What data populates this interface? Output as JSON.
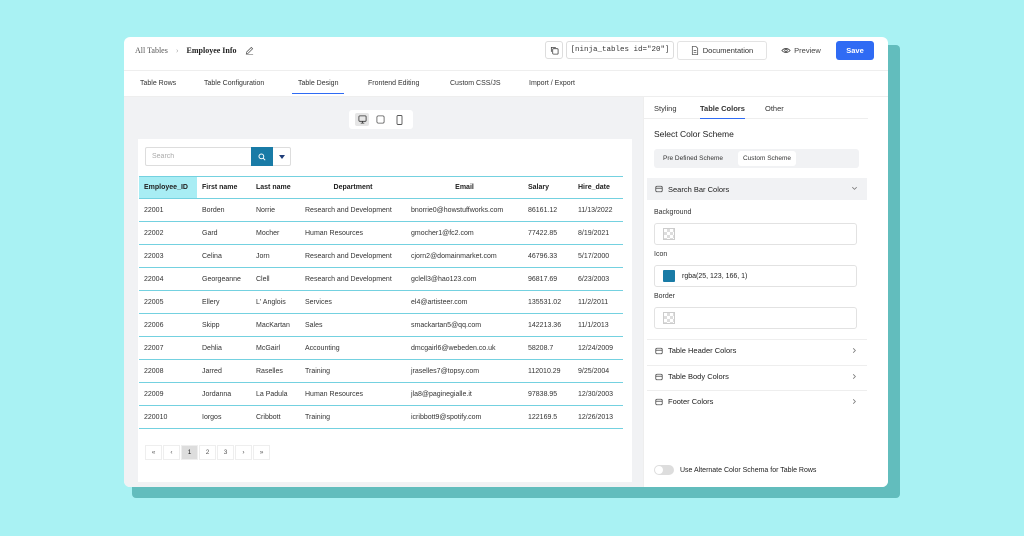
{
  "breadcrumb": {
    "root": "All Tables",
    "current": "Employee Info"
  },
  "header": {
    "shortcode": "[ninja_tables id=\"20\"]",
    "documentation_label": "Documentation",
    "preview_label": "Preview",
    "save_label": "Save"
  },
  "tabs": [
    "Table Rows",
    "Table Configuration",
    "Table Design",
    "Frontend Editing",
    "Custom CSS/JS",
    "Import / Export"
  ],
  "active_tab": "Table Design",
  "search": {
    "placeholder": "Search"
  },
  "table": {
    "columns": [
      "Employee_ID",
      "First name",
      "Last name",
      "Department",
      "Email",
      "Salary",
      "Hire_date"
    ],
    "rows": [
      [
        "22001",
        "Borden",
        "Norrie",
        "Research and Development",
        "bnorrie0@howstuffworks.com",
        "86161.12",
        "11/13/2022"
      ],
      [
        "22002",
        "Gard",
        "Mocher",
        "Human Resources",
        "gmocher1@fc2.com",
        "77422.85",
        "8/19/2021"
      ],
      [
        "22003",
        "Celina",
        "Jorn",
        "Research and Development",
        "cjorn2@domainmarket.com",
        "46796.33",
        "5/17/2000"
      ],
      [
        "22004",
        "Georgeanne",
        "Clell",
        "Research and Development",
        "gclell3@hao123.com",
        "96817.69",
        "6/23/2003"
      ],
      [
        "22005",
        "Ellery",
        "L' Anglois",
        "Services",
        "el4@artisteer.com",
        "135531.02",
        "11/2/2011"
      ],
      [
        "22006",
        "Skipp",
        "MacKartan",
        "Sales",
        "smackartan5@qq.com",
        "142213.36",
        "11/1/2013"
      ],
      [
        "22007",
        "Dehlia",
        "McGairl",
        "Accounting",
        "dmcgairl6@webeden.co.uk",
        "58208.7",
        "12/24/2009"
      ],
      [
        "22008",
        "Jarred",
        "Raselles",
        "Training",
        "jraselles7@topsy.com",
        "112010.29",
        "9/25/2004"
      ],
      [
        "22009",
        "Jordanna",
        "La Padula",
        "Human Resources",
        "jla8@paginegialle.it",
        "97838.95",
        "12/30/2003"
      ],
      [
        "220010",
        "Iorgos",
        "Cribbott",
        "Training",
        "icribbott9@spotify.com",
        "122169.5",
        "12/26/2013"
      ]
    ]
  },
  "pagination": [
    "«",
    "‹",
    "1",
    "2",
    "3",
    "›",
    "»"
  ],
  "right_panel": {
    "tabs": [
      "Styling",
      "Table Colors",
      "Other"
    ],
    "active_tab": "Table Colors",
    "section_title": "Select Color Scheme",
    "scheme_options": [
      "Pre Defined Scheme",
      "Custom Scheme"
    ],
    "active_scheme": "Custom Scheme",
    "search_bar_colors": {
      "title": "Search Bar Colors",
      "background_label": "Background",
      "icon_label": "Icon",
      "icon_value": "rgba(25, 123, 166, 1)",
      "border_label": "Border"
    },
    "sections": [
      "Table Header Colors",
      "Table Body Colors",
      "Footer Colors"
    ],
    "alternate_label": "Use Alternate Color Schema for Table Rows"
  },
  "colors": {
    "accent": "#2f6bf4",
    "icon_color": "#197ba6",
    "header_highlight": "#a8edf4",
    "row_border": "#74d1e0",
    "background": "#a9f2f3"
  }
}
